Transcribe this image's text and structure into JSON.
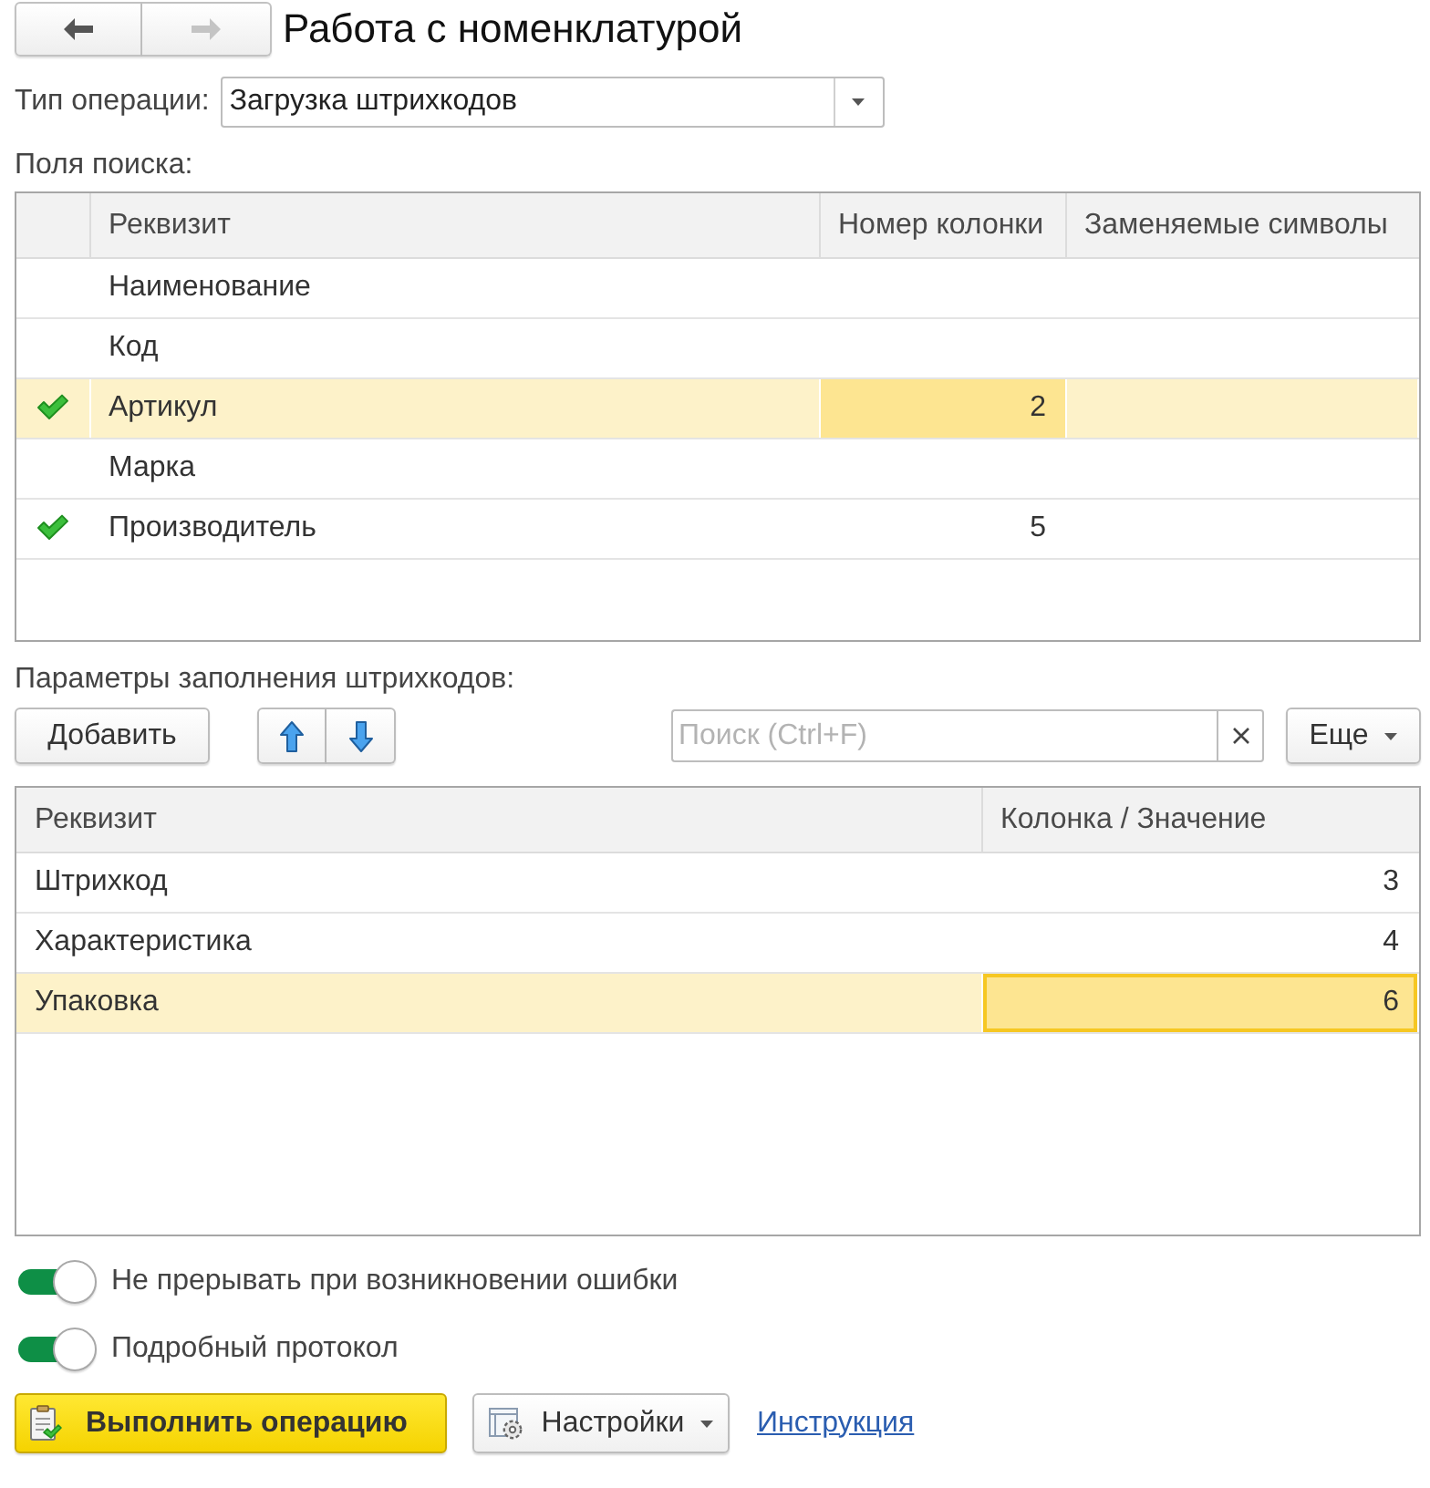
{
  "navigation": [
    {
      "kind": "back",
      "disabled": false
    },
    {
      "kind": "forward",
      "disabled": true
    }
  ],
  "title": "Работа с номенклатурой",
  "operation_type": {
    "label": "Тип операции:",
    "value": "Загрузка штрихкодов"
  },
  "search_fields": {
    "label": "Поля поиска:",
    "focused": false,
    "columns": [
      {
        "title": "Реквизит",
        "current": false
      },
      {
        "title": "Номер колонки",
        "current": true
      },
      {
        "title": "Заменяемые символы",
        "current": false
      }
    ],
    "rows": [
      {
        "checked": false,
        "selected": false,
        "attribute": "Наименование"
      },
      {
        "checked": false,
        "selected": false,
        "attribute": "Код"
      },
      {
        "checked": true,
        "selected": true,
        "attribute": "Артикул",
        "column_number": "2"
      },
      {
        "checked": false,
        "selected": false,
        "attribute": "Марка"
      },
      {
        "checked": true,
        "selected": false,
        "attribute": "Производитель",
        "column_number": "5"
      }
    ]
  },
  "barcode_params": {
    "label": "Параметры заполнения штрихкодов:",
    "add_button": "Добавить",
    "search": {
      "placeholder": "Поиск (Ctrl+F)"
    },
    "more_button": "Еще",
    "focused": true,
    "columns": [
      {
        "title": "Реквизит",
        "current": false
      },
      {
        "title": "Колонка / Значение",
        "current": true
      }
    ],
    "rows": [
      {
        "selected": false,
        "attribute": "Штрихкод",
        "value": "3"
      },
      {
        "selected": false,
        "attribute": "Характеристика",
        "value": "4"
      },
      {
        "selected": true,
        "attribute": "Упаковка",
        "value": "6"
      }
    ]
  },
  "toggles": [
    {
      "label": "Не прерывать при возникновении ошибки",
      "on": true
    },
    {
      "label": "Подробный протокол",
      "on": true
    }
  ],
  "run_button": "Выполнить операцию",
  "settings_button": "Настройки",
  "help_link": "Инструкция"
}
